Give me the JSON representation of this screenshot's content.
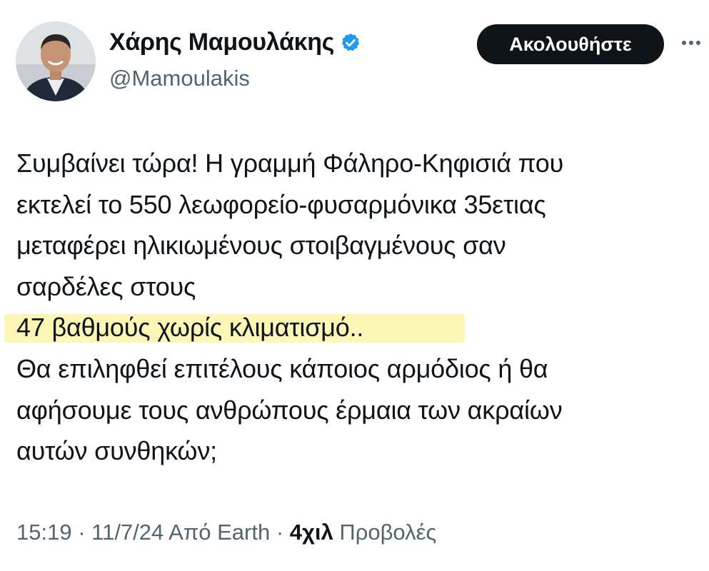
{
  "author": {
    "display_name": "Χάρης Μαμουλάκης",
    "handle": "@Mamoulakis",
    "verified": true
  },
  "actions": {
    "follow_label": "Ακολουθήστε",
    "more_icon": "more-horizontal-icon"
  },
  "tweet": {
    "lines": [
      "Συμβαίνει τώρα! Η γραμμή Φάληρο-Κηφισιά που",
      "εκτελεί το 550 λεωφορείο-φυσαρμόνικα 35ετιας",
      "μεταφέρει ηλικιωμένους στοιβαγμένους σαν",
      "σαρδέλες στους",
      "47 βαθμούς χωρίς κλιματισμό..",
      "Θα επιληφθεί επιτέλους κάποιος αρμόδιος ή θα",
      "αφήσουμε τους ανθρώπους έρμαια των ακραίων",
      "αυτών συνθηκών;"
    ]
  },
  "meta": {
    "time": "15:19",
    "sep1": " · ",
    "date": "11/7/24",
    "source": " Από Earth",
    "sep2": " · ",
    "views_count": "4χιλ",
    "views_label": " Προβολές"
  },
  "colors": {
    "verified": "#1d9bf0",
    "highlight": "#fbf6b6",
    "secondary_text": "#536471"
  }
}
